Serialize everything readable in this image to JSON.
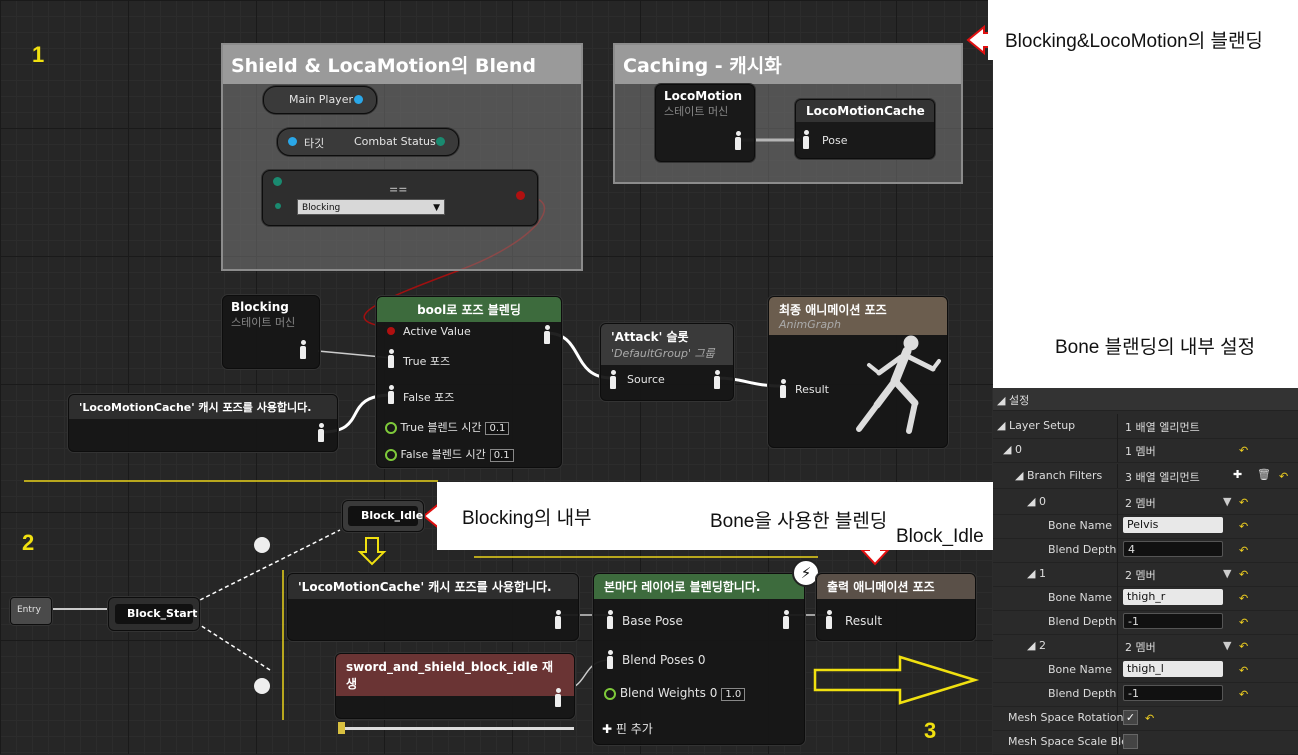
{
  "labels": {
    "one": "1",
    "two": "2",
    "three": "3"
  },
  "annotations": {
    "blending_title": "Blocking&LocoMotion의 블랜딩",
    "bone_settings": "Bone 블랜딩의 내부 설정",
    "blocking_inside": "Blocking의 내부",
    "bone_blending": "Bone을 사용한 블렌딩",
    "block_idle": "Block_Idle"
  },
  "comments": {
    "shield": "Shield & LocaMotion의 Blend",
    "caching": "Caching - 캐시화"
  },
  "nodes": {
    "main_player": "Main Player",
    "target": "타깃",
    "combat_status": "Combat Status",
    "equals": "==",
    "blocking_select": "Blocking",
    "locomotion": {
      "title": "LocoMotion",
      "sub": "스테이트 머신"
    },
    "locomotion_cache": {
      "title": "LocoMotionCache",
      "pin": "Pose"
    },
    "blocking": {
      "title": "Blocking",
      "sub": "스테이트 머신"
    },
    "bool_blend": {
      "title": "bool로 포즈 블렌딩",
      "active": "Active Value",
      "true_pose": "True 포즈",
      "false_pose": "False 포즈",
      "true_time": "True 블렌드 시간",
      "true_val": "0.1",
      "false_time": "False 블렌드 시간",
      "false_val": "0.1"
    },
    "use_cache_top": "'LocoMotionCache' 캐시 포즈를 사용합니다.",
    "attack_slot": {
      "title": "'Attack' 슬롯",
      "sub": "'DefaultGroup' 그룹",
      "source": "Source"
    },
    "final_pose": {
      "title": "최종 애니메이션 포즈",
      "sub": "AnimGraph",
      "result": "Result"
    },
    "entry": "Entry",
    "block_start": "Block_Start",
    "block_idle_state": "Block_Idle",
    "use_cache_bottom": "'LocoMotionCache' 캐시 포즈를 사용합니다.",
    "play_anim": "sword_and_shield_block_idle 재생",
    "layered": {
      "title": "본마다 레이어로 블렌딩합니다.",
      "base": "Base Pose",
      "blend_poses": "Blend Poses 0",
      "blend_weights": "Blend Weights 0",
      "weight_val": "1.0",
      "add_pin": "핀 추가"
    },
    "output_pose": {
      "title": "출력 애니메이션 포즈",
      "result": "Result"
    }
  },
  "panel": {
    "header": "설정",
    "rows": [
      {
        "label": "Layer Setup",
        "value": "1 배열 엘리먼트"
      },
      {
        "label": "0",
        "value": "1 멤버"
      },
      {
        "label": "Branch Filters",
        "value": "3 배열 엘리먼트"
      },
      {
        "label": "0",
        "value": "2 멤버"
      },
      {
        "label": "Bone Name",
        "value": "Pelvis"
      },
      {
        "label": "Blend Depth",
        "value": "4"
      },
      {
        "label": "1",
        "value": "2 멤버"
      },
      {
        "label": "Bone Name",
        "value": "thigh_r"
      },
      {
        "label": "Blend Depth",
        "value": "-1"
      },
      {
        "label": "2",
        "value": "2 멤버"
      },
      {
        "label": "Bone Name",
        "value": "thigh_l"
      },
      {
        "label": "Blend Depth",
        "value": "-1"
      },
      {
        "label": "Mesh Space Rotation",
        "value": ""
      },
      {
        "label": "Mesh Space Scale Ble",
        "value": ""
      }
    ]
  }
}
